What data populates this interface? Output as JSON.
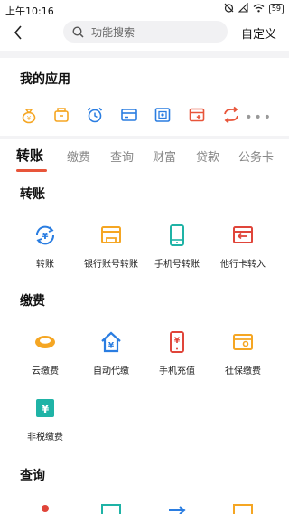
{
  "status_bar": {
    "time": "上午10:16",
    "battery": "59"
  },
  "header": {
    "search_placeholder": "功能搜索",
    "customize_label": "自定义"
  },
  "my_apps": {
    "title": "我的应用",
    "icons": [
      "money-bag-icon",
      "wallet-icon",
      "alarm-clock-icon",
      "card-icon",
      "safe-icon",
      "calendar-plus-icon",
      "exchange-icon",
      "more-icon"
    ]
  },
  "tabs": [
    {
      "label": "转账",
      "active": true
    },
    {
      "label": "缴费",
      "active": false
    },
    {
      "label": "查询",
      "active": false
    },
    {
      "label": "财富",
      "active": false
    },
    {
      "label": "贷款",
      "active": false
    },
    {
      "label": "公务卡",
      "active": false
    }
  ],
  "sections": {
    "transfer": {
      "title": "转账",
      "items": [
        "转账",
        "银行账号转账",
        "手机号转账",
        "他行卡转入"
      ]
    },
    "payment": {
      "title": "缴费",
      "items": [
        "云缴费",
        "自动代缴",
        "手机充值",
        "社保缴费",
        "非税缴费"
      ]
    },
    "query": {
      "title": "查询"
    }
  },
  "colors": {
    "accent_orange": "#f5a623",
    "blue": "#2a7de1",
    "teal": "#1fb3a6",
    "red": "#e0453a",
    "tab_underline": "#e8553a"
  }
}
